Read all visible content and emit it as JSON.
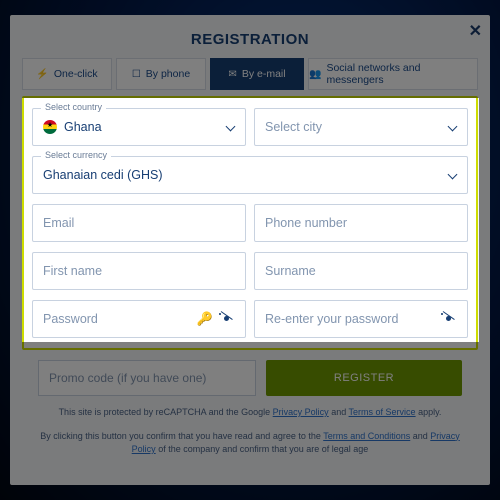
{
  "modal": {
    "title": "REGISTRATION",
    "close": "✕"
  },
  "tabs": {
    "oneclick": "One-click",
    "phone": "By phone",
    "email": "By e-mail",
    "social": "Social networks and messengers"
  },
  "fields": {
    "country_legend": "Select country",
    "country_value": "Ghana",
    "city_placeholder": "Select city",
    "currency_legend": "Select currency",
    "currency_value": "Ghanaian cedi (GHS)",
    "email_placeholder": "Email",
    "phone_placeholder": "Phone number",
    "firstname_placeholder": "First name",
    "surname_placeholder": "Surname",
    "password_placeholder": "Password",
    "repassword_placeholder": "Re-enter your password"
  },
  "bottom": {
    "promo_placeholder": "Promo code (if you have one)",
    "register_label": "REGISTER"
  },
  "fineprint": {
    "recaptcha_pre": "This site is protected by reCAPTCHA and the Google ",
    "privacy": "Privacy Policy",
    "and": " and ",
    "tos": "Terms of Service",
    "apply": " apply.",
    "confirm_pre": "By clicking this button you confirm that you have read and agree to the ",
    "tac": "Terms and Conditions",
    "confirm_mid": " and ",
    "pp2": "Privacy Policy",
    "confirm_post": " of the company and confirm that you are of legal age"
  },
  "icons": {
    "bolt": "⚡",
    "phone": "☐",
    "mail": "✉",
    "people": "👥",
    "key": "🔑"
  }
}
